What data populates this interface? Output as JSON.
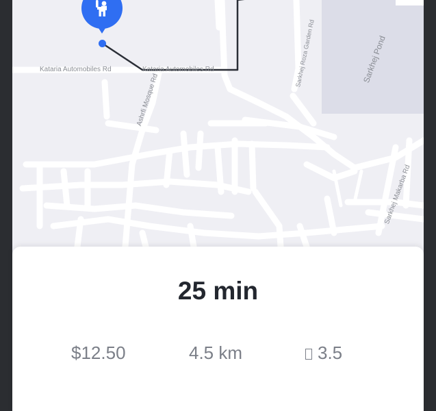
{
  "map": {
    "street_labels": {
      "kataria_left": "Kataria Automobiles Rd",
      "kataria_right": "Kataria Automobiles Rd",
      "ashrfi": "Ashrfi Mosque Rd",
      "roza": "Sarkhej Roza Garden Rd",
      "pond": "Sarkhej Pond",
      "makarba": "Sarkhej Makarba Rd"
    },
    "pin_icon": "person-waving-icon",
    "colors": {
      "route": "#2a2e36",
      "pin": "#2f6ef2",
      "map_bg": "#efeff4",
      "road": "#ffffff",
      "pond": "#dcdde8"
    }
  },
  "trip": {
    "eta": "25 min",
    "price": "$12.50",
    "distance": "4.5 km",
    "rating": "3.5",
    "rating_icon": "rating-icon"
  }
}
